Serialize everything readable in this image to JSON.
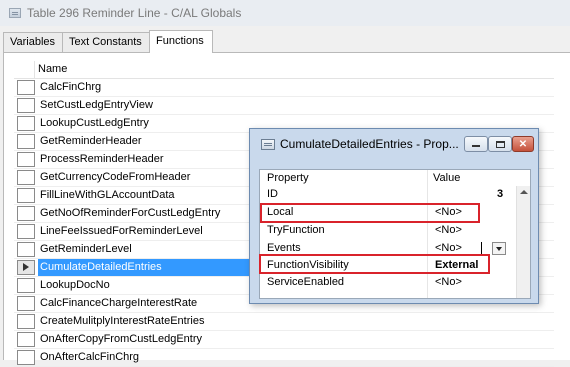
{
  "window": {
    "title": "Table 296 Reminder Line - C/AL Globals"
  },
  "tabs": [
    {
      "label": "Variables",
      "active": false
    },
    {
      "label": "Text Constants",
      "active": false
    },
    {
      "label": "Functions",
      "active": true
    }
  ],
  "grid": {
    "header": "Name",
    "rows": [
      {
        "name": "CalcFinChrg"
      },
      {
        "name": "SetCustLedgEntryView"
      },
      {
        "name": "LookupCustLedgEntry"
      },
      {
        "name": "GetReminderHeader"
      },
      {
        "name": "ProcessReminderHeader"
      },
      {
        "name": "GetCurrencyCodeFromHeader"
      },
      {
        "name": "FillLineWithGLAccountData"
      },
      {
        "name": "GetNoOfReminderForCustLedgEntry"
      },
      {
        "name": "LineFeeIssuedForReminderLevel"
      },
      {
        "name": "GetReminderLevel"
      },
      {
        "name": "CumulateDetailedEntries",
        "selected": true
      },
      {
        "name": "LookupDocNo"
      },
      {
        "name": "CalcFinanceChargeInterestRate"
      },
      {
        "name": "CreateMulitplyInterestRateEntries"
      },
      {
        "name": "OnAfterCopyFromCustLedgEntry"
      },
      {
        "name": "OnAfterCalcFinChrg"
      }
    ]
  },
  "properties_window": {
    "title": "CumulateDetailedEntries - Prop...",
    "col_property": "Property",
    "col_value": "Value",
    "rows": [
      {
        "property": "ID",
        "value": "3"
      },
      {
        "property": "Local",
        "value": "<No>"
      },
      {
        "property": "TryFunction",
        "value": "<No>"
      },
      {
        "property": "Events",
        "value": "<No>"
      },
      {
        "property": "FunctionVisibility",
        "value": "External"
      },
      {
        "property": "ServiceEnabled",
        "value": "<No>"
      }
    ],
    "highlight_color": "#d9232b",
    "selection_color": "#3399ff"
  }
}
